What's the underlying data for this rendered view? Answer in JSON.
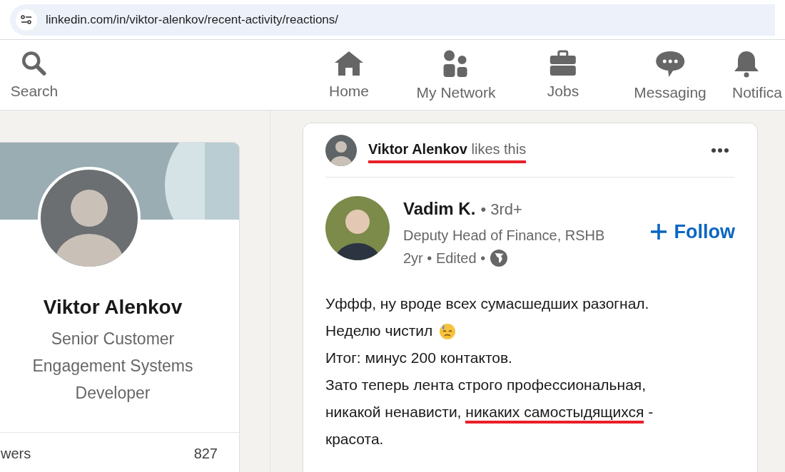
{
  "browser": {
    "url": "linkedin.com/in/viktor-alenkov/recent-activity/reactions/"
  },
  "nav": {
    "items": [
      {
        "label": "Search",
        "kind": "search"
      },
      {
        "label": "Home",
        "kind": "home"
      },
      {
        "label": "My Network",
        "kind": "network"
      },
      {
        "label": "Jobs",
        "kind": "jobs"
      },
      {
        "label": "Messaging",
        "kind": "messaging"
      },
      {
        "label": "Notifica",
        "kind": "notifications"
      }
    ]
  },
  "profile_card": {
    "name": "Viktor Alenkov",
    "headline": "Senior Customer Engagement Systems Developer",
    "stats": [
      {
        "label": "wers",
        "value": "827"
      }
    ]
  },
  "post": {
    "actor": {
      "name": "Viktor Alenkov",
      "action": "likes this",
      "highlighted": true
    },
    "author": {
      "name": "Vadim K.",
      "degree": "• 3rd+",
      "headline": "Deputy Head of Finance, RSHB",
      "meta": "2yr • Edited •"
    },
    "follow_label": "Follow",
    "body": [
      [
        {
          "kind": "text",
          "text": "Уффф, ну вроде всех сумасшедших разогнал.",
          "highlighted": false
        }
      ],
      [
        {
          "kind": "text",
          "text": "Неделю чистил",
          "highlighted": false
        },
        {
          "kind": "emoji"
        }
      ],
      [
        {
          "kind": "text",
          "text": "Итог: минус 200 контактов.",
          "highlighted": false
        }
      ],
      [
        {
          "kind": "text",
          "text": "Зато теперь лента строго профессиональная,",
          "highlighted": false
        }
      ],
      [
        {
          "kind": "text",
          "text": "никакой ненависти, ",
          "highlighted": false
        },
        {
          "kind": "text",
          "text": "никаких самостыдящихся",
          "highlighted": true
        },
        {
          "kind": "text",
          "text": " -",
          "highlighted": false
        }
      ],
      [
        {
          "kind": "text",
          "text": "красота.",
          "highlighted": false
        }
      ]
    ]
  }
}
